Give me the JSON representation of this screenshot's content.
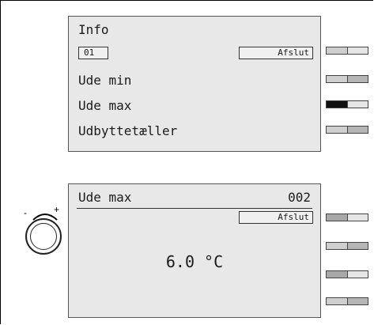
{
  "panel_top": {
    "title": "Info",
    "field_value": "01",
    "exit_label": "Afslut",
    "items": [
      "Ude min",
      "Ude max",
      "Udbyttetæller"
    ]
  },
  "panel_bottom": {
    "title": "Ude max",
    "code": "002",
    "exit_label": "Afslut",
    "value": "6.0 °C"
  },
  "knob": {
    "minus": "-",
    "plus": "+"
  }
}
